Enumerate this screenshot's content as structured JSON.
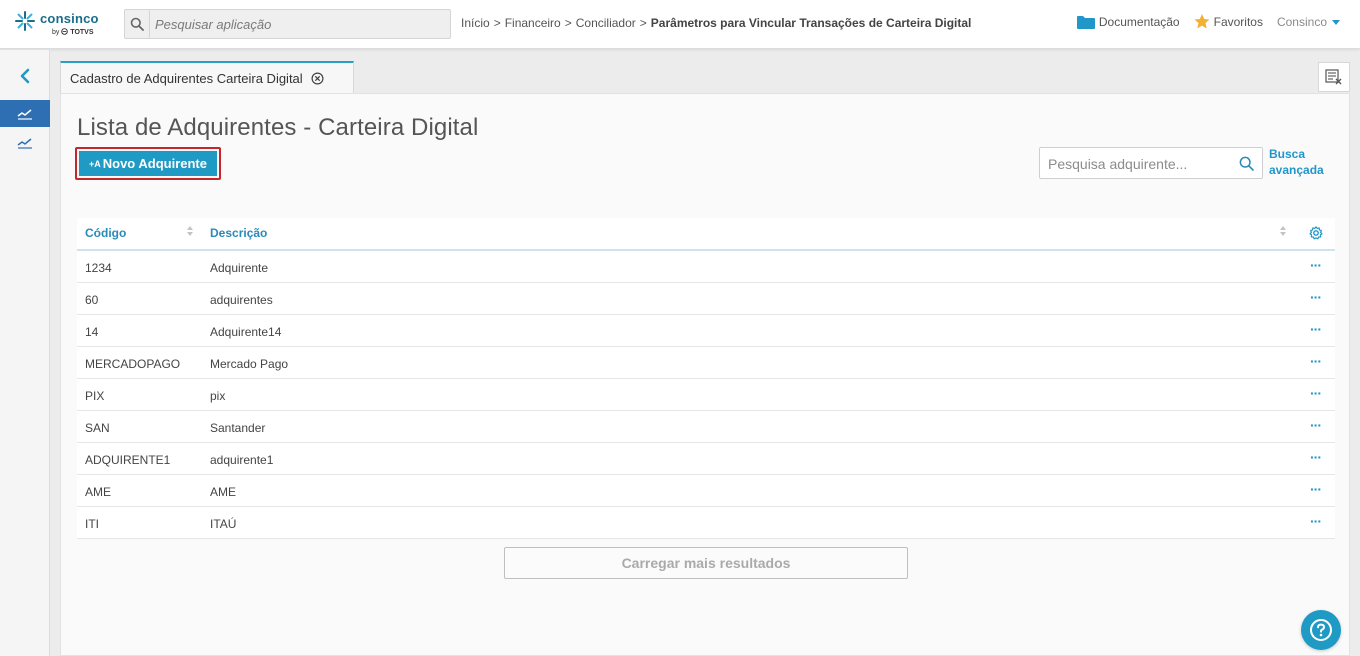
{
  "brand": {
    "name": "consinco",
    "by": "by",
    "parent": "TOTVS"
  },
  "search_app": {
    "placeholder": "Pesquisar aplicação"
  },
  "breadcrumb": {
    "items": [
      "Início",
      "Financeiro",
      "Conciliador"
    ],
    "separator": ">",
    "current": "Parâmetros para Vincular Transações de Carteira Digital"
  },
  "header": {
    "documentation": "Documentação",
    "favorites": "Favoritos",
    "user": "Consinco"
  },
  "tab": {
    "label": "Cadastro de Adquirentes Carteira Digital"
  },
  "page": {
    "title": "Lista de Adquirentes - Carteira Digital",
    "new_button_prefix": "+A",
    "new_button": "Novo Adquirente",
    "search_placeholder": "Pesquisa adquirente...",
    "advanced_search": "Busca avançada",
    "load_more": "Carregar mais resultados"
  },
  "table": {
    "columns": [
      "Código",
      "Descrição"
    ],
    "row_action": "···",
    "rows": [
      {
        "code": "1234",
        "description": "Adquirente"
      },
      {
        "code": "60",
        "description": "adquirentes"
      },
      {
        "code": "14",
        "description": "Adquirente14"
      },
      {
        "code": "MERCADOPAGO",
        "description": "Mercado Pago"
      },
      {
        "code": "PIX",
        "description": "pix"
      },
      {
        "code": "SAN",
        "description": "Santander"
      },
      {
        "code": "ADQUIRENTE1",
        "description": "adquirente1"
      },
      {
        "code": "AME",
        "description": "AME"
      },
      {
        "code": "ITI",
        "description": "ITAÚ"
      }
    ]
  },
  "colors": {
    "accent": "#1f9ac5",
    "link": "#2196c9",
    "sidebar_active": "#2e6fb3",
    "highlight_border": "#c4262e",
    "favorite_star": "#f2b134",
    "folder": "#2196c9"
  },
  "icons": {
    "search": "search-icon",
    "folder": "folder-icon",
    "star": "star-icon",
    "back": "chevron-left-icon",
    "chart": "line-chart-icon",
    "close": "close-circle-icon",
    "gear": "gear-icon",
    "help": "help-icon",
    "tab_tool": "list-clear-icon"
  }
}
